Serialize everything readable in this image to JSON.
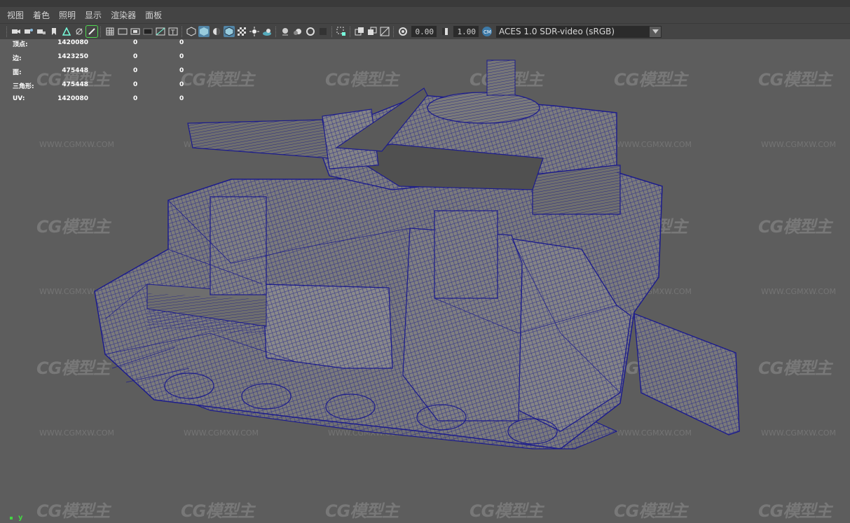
{
  "menu": [
    "视图",
    "着色",
    "照明",
    "显示",
    "渲染器",
    "面板"
  ],
  "toolbar": {
    "exposure_value": "0.00",
    "gamma_value": "1.00",
    "color_management": "ACES 1.0 SDR-video (sRGB)",
    "icons": [
      "camera-icon",
      "camera-attr-icon",
      "camera-lock-icon",
      "bookmark-icon",
      "image-plane-icon",
      "grease-pencil-icon",
      "grid-icon",
      "film-gate-icon",
      "resolution-gate-icon",
      "gate-mask-icon",
      "field-chart-icon",
      "safe-action-icon",
      "wireframe-icon",
      "smooth-shade-icon",
      "default-material-icon",
      "wireframe-on-shaded-icon",
      "textured-icon",
      "use-all-lights-icon",
      "shadows-icon",
      "screen-space-ao-icon",
      "motion-blur-icon",
      "anti-alias-icon",
      "depth-of-field-icon",
      "isolate-select-icon",
      "xray-icon",
      "xray-joints-icon",
      "xray-components-icon",
      "exposure-icon",
      "gamma-icon",
      "color-management-icon"
    ]
  },
  "hud": {
    "rows": [
      {
        "label": "顶点:",
        "values": [
          "1420080",
          "0",
          "0"
        ]
      },
      {
        "label": "边:",
        "values": [
          "1423250",
          "0",
          "0"
        ]
      },
      {
        "label": "面:",
        "values": [
          "475448",
          "0",
          "0"
        ]
      },
      {
        "label": "三角形:",
        "values": [
          "475448",
          "0",
          "0"
        ]
      },
      {
        "label": "UV:",
        "values": [
          "1420080",
          "0",
          "0"
        ]
      }
    ]
  },
  "watermark": {
    "logo": "CG模型主",
    "url": "WWW.CGMXW.COM"
  },
  "axis_label": "y",
  "colors": {
    "viewport_bg": "#5d5d5d",
    "wireframe": "#1c1c8c",
    "mesh_fill": "#7a7a7a",
    "active_icon": "#5285a6"
  }
}
